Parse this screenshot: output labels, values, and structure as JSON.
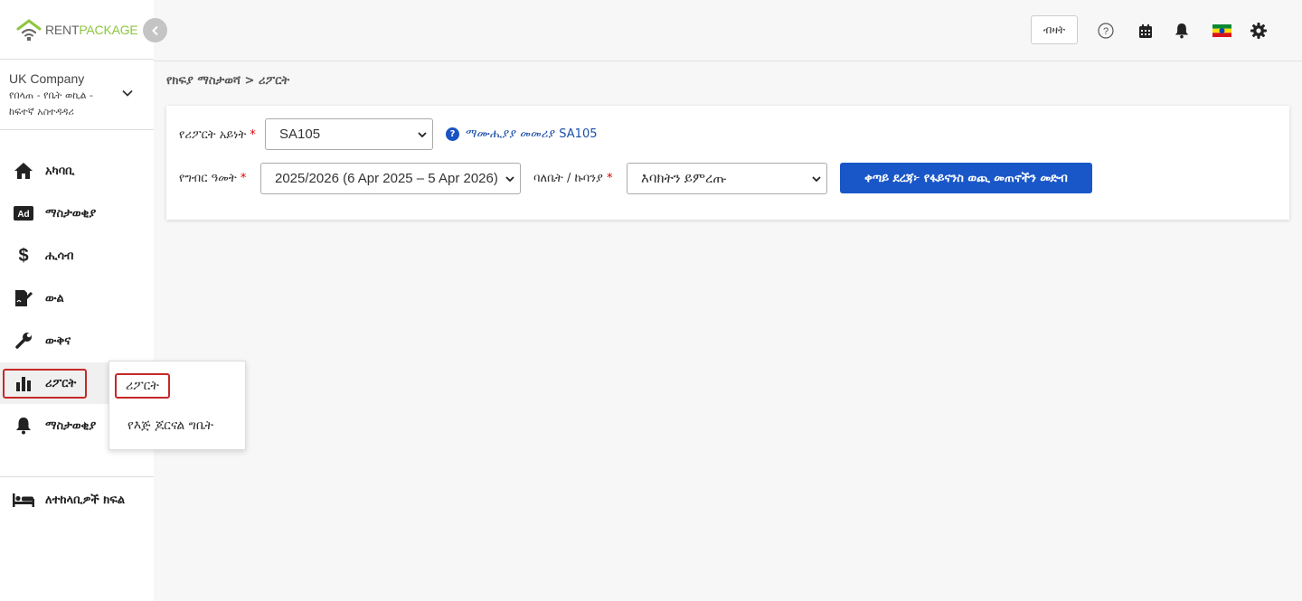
{
  "brand": {
    "part1": "RENT",
    "part2": "PACKAGE"
  },
  "company": {
    "name": "UK Company",
    "role": "የበላጠ - የቤት ወኪል - ከፍተኛ አስተዳዳሪ"
  },
  "sidebar": {
    "items": [
      {
        "label": "አካባቢ",
        "icon": "home-icon"
      },
      {
        "label": "ማስታወቂያ",
        "icon": "ad-icon"
      },
      {
        "label": "ሒሳብ",
        "icon": "dollar-icon"
      },
      {
        "label": "ውል",
        "icon": "contract-icon"
      },
      {
        "label": "ውቅና",
        "icon": "wrench-icon"
      },
      {
        "label": "ሪፖርት",
        "icon": "bar-chart-icon"
      },
      {
        "label": "ማስታወቂያ",
        "icon": "bell-icon"
      },
      {
        "label": "ለተከላቢዎች ክፍል",
        "icon": "bed-icon"
      }
    ],
    "active_index": 5
  },
  "topbar": {
    "lang_label": "ብዛት",
    "icons": [
      "help-icon",
      "calendar-icon",
      "bell-icon",
      "flag-icon",
      "gear-icon"
    ]
  },
  "breadcrumb": "የክፍያ ማስታወሻ > ሪፖርት",
  "form": {
    "report_type_label": "የሪፖርት አይነት",
    "report_type_value": "SA105",
    "help_link": "ማሙሒያያ መመሪያ SA105",
    "tax_year_label": "የግብር ዓመት",
    "tax_year_value": "2025/2026 (6 Apr 2025 – 5 Apr 2026)",
    "owner_label": "ባለቤት / ኩባንያ",
    "owner_value": "እባክትን ይምረጡ",
    "next_button": "ቀጣይ ደረጃ፦ የፋይናንስ ወጪ መጠኖችን መድብ"
  },
  "popup": {
    "items": [
      "ሪፖርት",
      "የእጅ ጆርናል ግቤት"
    ]
  },
  "colors": {
    "primary": "#1957c8",
    "brand_green": "#8dc63f",
    "highlight": "#c62828"
  }
}
